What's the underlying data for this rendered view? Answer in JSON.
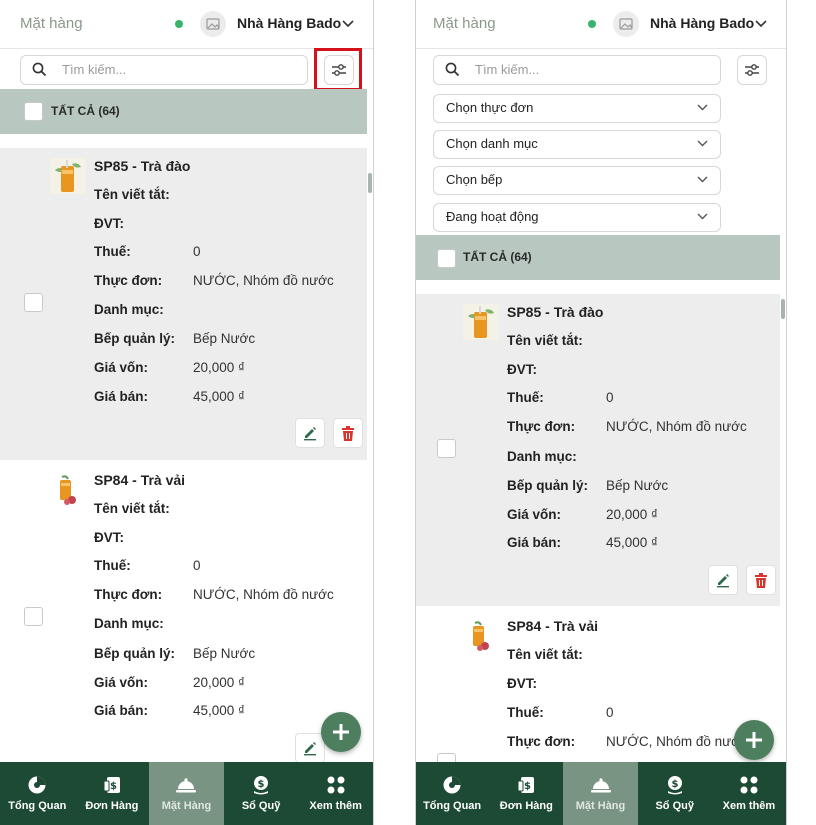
{
  "header": {
    "title": "Mặt hàng",
    "store_name": "Nhà Hàng Bado"
  },
  "search": {
    "placeholder": "Tìm kiếm..."
  },
  "filters": [
    "Chọn thực đơn",
    "Chọn danh mục",
    "Chọn bếp",
    "Đang hoạt động"
  ],
  "select_all": {
    "label": "TẤT CẢ (64)"
  },
  "field_labels": {
    "short_name": "Tên viết tắt:",
    "unit": "ĐVT:",
    "tax": "Thuế:",
    "menu": "Thực đơn:",
    "category": "Danh mục:",
    "kitchen": "Bếp quản lý:",
    "cost": "Giá vốn:",
    "price": "Giá bán:"
  },
  "products": [
    {
      "name": "SP85 - Trà đào",
      "short_name": "",
      "unit": "",
      "tax": "0",
      "menu": "NƯỚC, Nhóm đồ nước",
      "category": "",
      "kitchen": "Bếp Nước",
      "cost": "20,000 ₫",
      "price": "45,000 ₫",
      "image": "peach-tea-image"
    },
    {
      "name": "SP84 - Trà vải",
      "short_name": "",
      "unit": "",
      "tax": "0",
      "menu": "NƯỚC, Nhóm đồ nước",
      "category": "",
      "kitchen": "Bếp Nước",
      "cost": "20,000 ₫",
      "price": "45,000 ₫",
      "image": "lychee-tea-image"
    }
  ],
  "bottom_nav": [
    {
      "label": "Tổng Quan",
      "icon": "pie-chart-icon"
    },
    {
      "label": "Đơn Hàng",
      "icon": "receipt-icon"
    },
    {
      "label": "Mặt Hàng",
      "icon": "cloche-icon",
      "active": true
    },
    {
      "label": "Sổ Quỹ",
      "icon": "money-bag-icon"
    },
    {
      "label": "Xem thêm",
      "icon": "grid-icon"
    }
  ],
  "colors": {
    "brand": "#1d4a34",
    "active_tab": "#7a9483",
    "highlight": "#d3121b",
    "accent": "#4d7e5e",
    "delete": "#d9352c"
  }
}
